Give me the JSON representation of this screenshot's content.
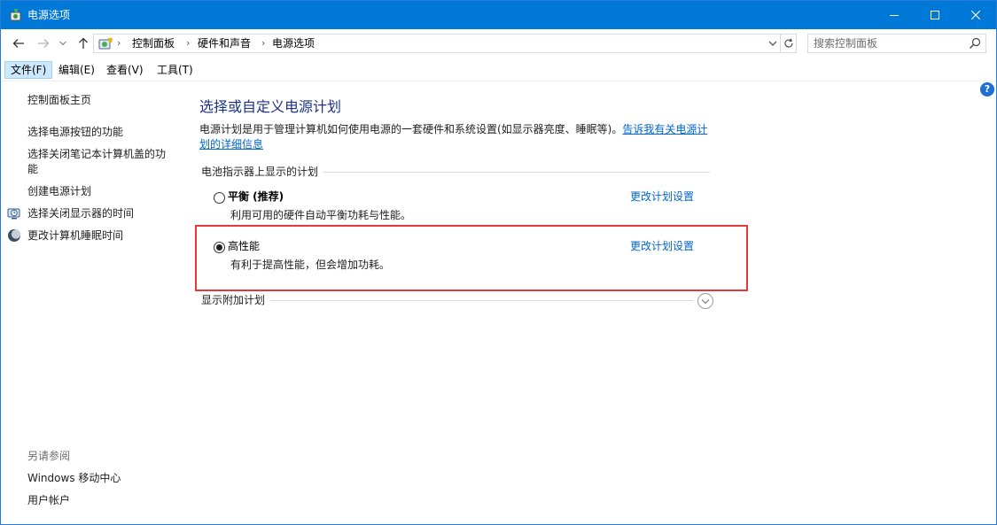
{
  "window": {
    "title": "电源选项",
    "controls": {
      "minimize": "minimize",
      "maximize": "maximize",
      "close": "close"
    }
  },
  "address": {
    "crumbs": [
      "控制面板",
      "硬件和声音",
      "电源选项"
    ],
    "separator": "›"
  },
  "search": {
    "placeholder": "搜索控制面板"
  },
  "menu": {
    "file": "文件(F)",
    "edit": "编辑(E)",
    "view": "查看(V)",
    "tools": "工具(T)"
  },
  "sidebar": {
    "home": "控制面板主页",
    "items": [
      {
        "label": "选择电源按钮的功能",
        "icon": ""
      },
      {
        "label_line1": "选择关闭笔记本计算机盖的功",
        "label_line2": "能",
        "icon": ""
      },
      {
        "label": "创建电源计划",
        "icon": ""
      },
      {
        "label": "选择关闭显示器的时间",
        "icon": "clock-monitor-icon"
      },
      {
        "label": "更改计算机睡眠时间",
        "icon": "moon-sleep-icon"
      }
    ],
    "see_also_title": "另请参阅",
    "see_also": [
      "Windows 移动中心",
      "用户帐户"
    ]
  },
  "main": {
    "heading": "选择或自定义电源计划",
    "description_line1": "电源计划是用于管理计算机如何使用电源的一套硬件和系统设置(如显示器亮度、睡眠等)。",
    "description_link_part1": "告诉我有关电源计",
    "description_link_part2": "划的详细信息",
    "group_label": "电池指示器上显示的计划",
    "plans": [
      {
        "name": "平衡 (推荐)",
        "desc": "利用可用的硬件自动平衡功耗与性能。",
        "link": "更改计划设置",
        "selected": false
      },
      {
        "name": "高性能",
        "desc": "有利于提高性能，但会增加功耗。",
        "link": "更改计划设置",
        "selected": true
      }
    ],
    "more_plans_label": "显示附加计划"
  },
  "colors": {
    "titlebar": "#0078d7",
    "heading": "#1e3287",
    "link": "#0066cc",
    "highlight": "#e03a3a"
  }
}
